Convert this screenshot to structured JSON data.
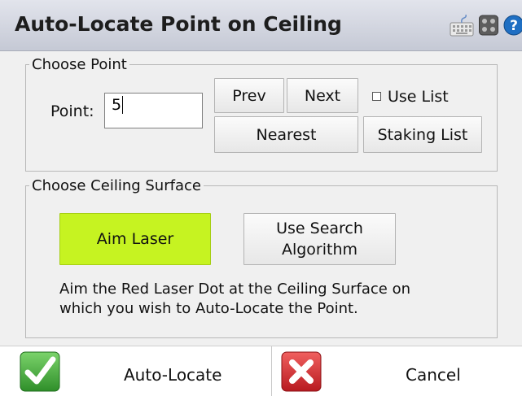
{
  "title": "Auto-Locate Point on Ceiling",
  "titlebar_icons": [
    "keyboard-icon",
    "settings-icon",
    "help-icon"
  ],
  "choose_point": {
    "legend": "Choose Point",
    "point_label": "Point:",
    "point_value": "5",
    "prev_label": "Prev",
    "next_label": "Next",
    "use_list_label": "Use List",
    "nearest_label": "Nearest",
    "staking_list_label": "Staking List"
  },
  "ceiling": {
    "legend": "Choose Ceiling Surface",
    "aim_laser_label": "Aim Laser",
    "use_search_label_line1": "Use Search",
    "use_search_label_line2": "Algorithm",
    "description_line1": "Aim the Red Laser Dot at the Ceiling Surface on",
    "description_line2": "which you wish to Auto-Locate the Point."
  },
  "footer": {
    "auto_locate_label": "Auto-Locate",
    "cancel_label": "Cancel"
  },
  "colors": {
    "aim_laser_bg": "#c6f321",
    "ok_icon": "#3aa633",
    "cancel_icon": "#d8262c",
    "help_icon": "#1f6fc3"
  }
}
